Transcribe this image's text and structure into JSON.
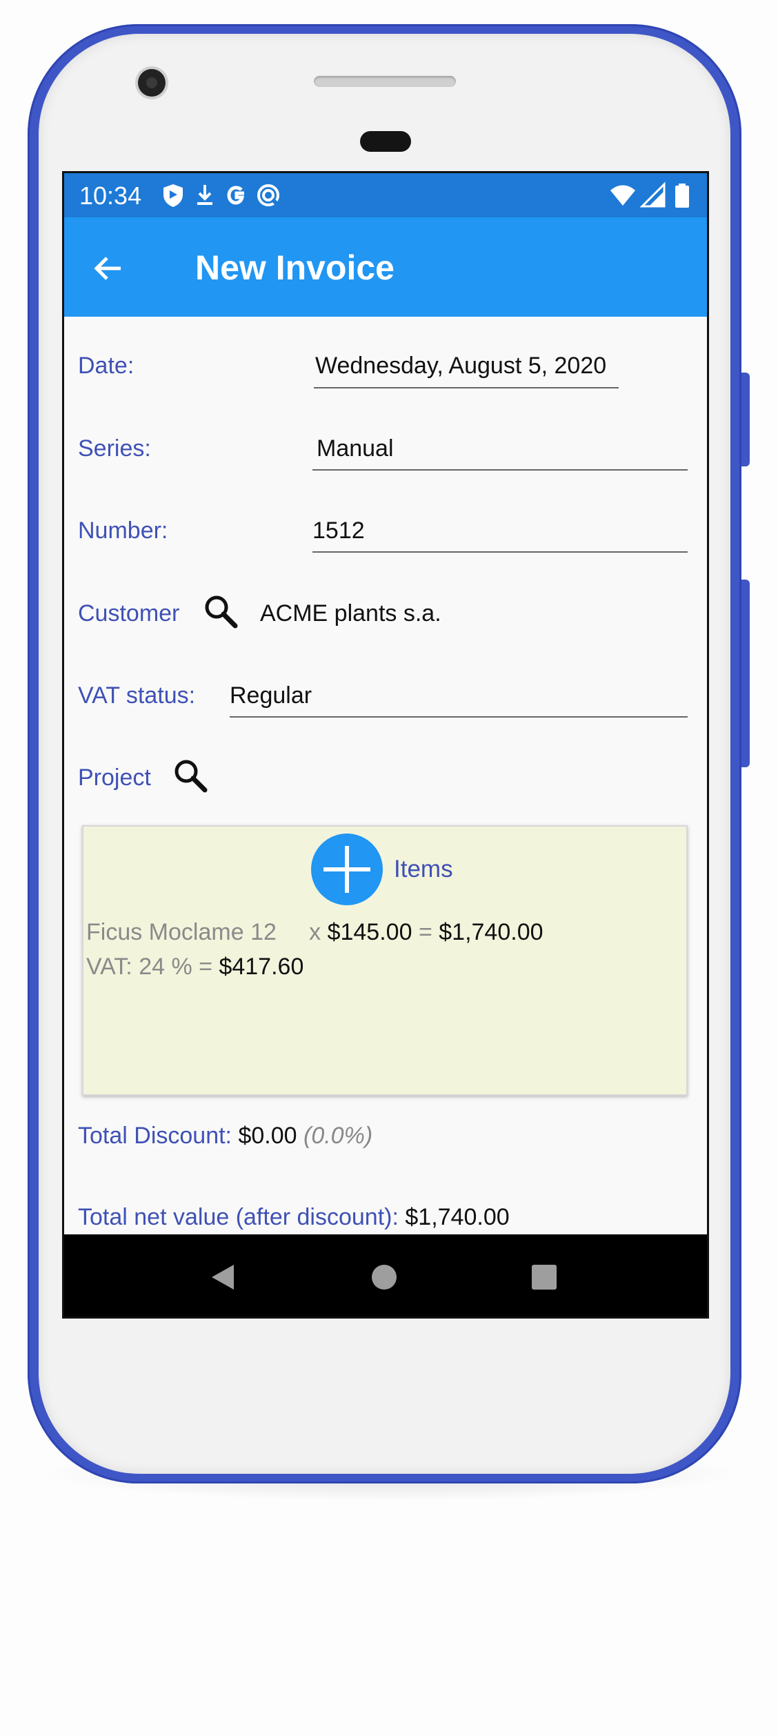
{
  "status_bar": {
    "time": "10:34",
    "left_icons": [
      "shield-icon",
      "download-icon",
      "google-icon",
      "sync-icon"
    ],
    "right_icons": [
      "wifi-icon",
      "signal-icon",
      "battery-icon"
    ]
  },
  "app_bar": {
    "title": "New Invoice",
    "back_icon": "arrow-left-icon"
  },
  "form": {
    "date_label": "Date:",
    "date_value": "Wednesday, August 5, 2020",
    "series_label": "Series:",
    "series_value": "Manual",
    "number_label": "Number:",
    "number_value": "1512",
    "customer_label": "Customer",
    "customer_value": "ACME plants s.a.",
    "vat_status_label": "VAT status:",
    "vat_status_value": "Regular",
    "project_label": "Project",
    "project_value": ""
  },
  "items": {
    "label": "Items",
    "add_icon": "plus-icon",
    "lines": [
      {
        "name": "Ficus Moclame",
        "quantity": "12",
        "times": "x",
        "price": "$145.00",
        "equals": "=",
        "total": "$1,740.00",
        "vat_label": "VAT: 24 % =",
        "vat_value": "$417.60"
      }
    ]
  },
  "totals": {
    "discount_label": "Total Discount:",
    "discount_value": "$0.00",
    "discount_percent": "(0.0%)",
    "net_label": "Total net value (after discount):",
    "net_value": "$1,740.00"
  },
  "nav_bar": {
    "icons": [
      "back-triangle-icon",
      "home-circle-icon",
      "recents-square-icon"
    ]
  },
  "colors": {
    "status_bar": "#1e7ad6",
    "app_bar": "#2196f3",
    "label": "#3f51b5",
    "items_background": "#f3f4dc",
    "phone_frame": "#3f56c6"
  }
}
